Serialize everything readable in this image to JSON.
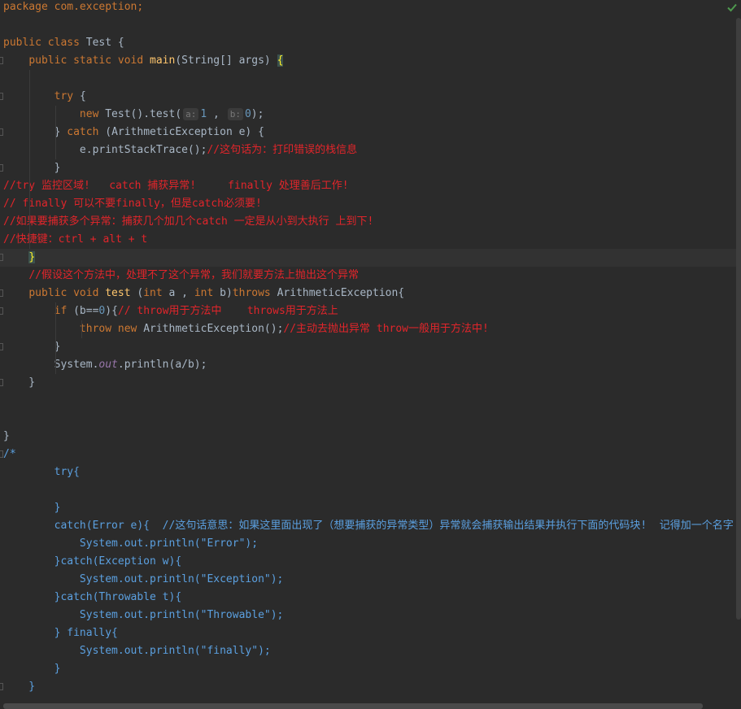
{
  "editor": {
    "status_icon": "check-icon",
    "lines": [
      [
        {
          "t": "package com.exception;",
          "c": "kw2"
        }
      ],
      [],
      [
        {
          "t": "public class ",
          "c": "kw"
        },
        {
          "t": "Test {",
          "c": ""
        }
      ],
      [
        {
          "t": "    "
        },
        {
          "t": "public static void ",
          "c": "kw"
        },
        {
          "t": "main",
          "c": "fn"
        },
        {
          "t": "(String[] args) "
        },
        {
          "t": "{",
          "c": "brace"
        }
      ],
      [],
      [
        {
          "t": "        "
        },
        {
          "t": "try ",
          "c": "kw"
        },
        {
          "t": "{"
        }
      ],
      [
        {
          "t": "            "
        },
        {
          "t": "new ",
          "c": "kw"
        },
        {
          "t": "Test().test("
        },
        {
          "hint": "a:"
        },
        {
          "t": "1",
          "c": "num"
        },
        {
          "t": " , "
        },
        {
          "hint": "b:"
        },
        {
          "t": "0",
          "c": "num"
        },
        {
          "t": ");"
        }
      ],
      [
        {
          "t": "        } "
        },
        {
          "t": "catch ",
          "c": "kw"
        },
        {
          "t": "(ArithmeticException e) {"
        }
      ],
      [
        {
          "t": "            e.printStackTrace();"
        },
        {
          "t": "//这句话为：打印错误的栈信息",
          "c": "red"
        }
      ],
      [
        {
          "t": "        }"
        }
      ],
      [
        {
          "t": "//try 监控区域!   catch 捕获异常!     finally 处理善后工作!",
          "c": "red"
        }
      ],
      [
        {
          "t": "// finally 可以不要finally，但是catch必须要!",
          "c": "red"
        }
      ],
      [
        {
          "t": "//如果要捕获多个异常：捕获几个加几个catch 一定是从小到大执行 上到下!",
          "c": "red"
        }
      ],
      [
        {
          "t": "//快捷键：ctrl + alt + t",
          "c": "red"
        }
      ],
      [
        {
          "t": "    "
        },
        {
          "t": "}",
          "c": "brace"
        }
      ],
      [
        {
          "t": "    "
        },
        {
          "t": "//假设这个方法中，处理不了这个异常，我们就要方法上抛出这个异常",
          "c": "red"
        }
      ],
      [
        {
          "t": "    "
        },
        {
          "t": "public void ",
          "c": "kw"
        },
        {
          "t": "test ",
          "c": "fn"
        },
        {
          "t": "(",
          "c": ""
        },
        {
          "t": "int ",
          "c": "kw"
        },
        {
          "t": "a , "
        },
        {
          "t": "int ",
          "c": "kw"
        },
        {
          "t": "b)"
        },
        {
          "t": "throws ",
          "c": "kw"
        },
        {
          "t": "ArithmeticException{"
        }
      ],
      [
        {
          "t": "        "
        },
        {
          "t": "if ",
          "c": "kw"
        },
        {
          "t": "(b=="
        },
        {
          "t": "0",
          "c": "num"
        },
        {
          "t": "){"
        },
        {
          "t": "// throw用于方法中    throws用于方法上",
          "c": "red"
        }
      ],
      [
        {
          "t": "            "
        },
        {
          "t": "throw new ",
          "c": "kw"
        },
        {
          "t": "ArithmeticException();"
        },
        {
          "t": "//主动去抛出异常 throw一般用于方法中!",
          "c": "red"
        }
      ],
      [
        {
          "t": "        }"
        }
      ],
      [
        {
          "t": "        System."
        },
        {
          "t": "out",
          "c": "field"
        },
        {
          "t": ".println(a/b);"
        }
      ],
      [
        {
          "t": "    }"
        }
      ],
      [],
      [],
      [
        {
          "t": "}"
        }
      ],
      [
        {
          "t": "/*",
          "c": "blue"
        }
      ],
      [
        {
          "t": "        try{",
          "c": "blue"
        }
      ],
      [],
      [
        {
          "t": "        }",
          "c": "blue"
        }
      ],
      [
        {
          "t": "        catch(Error e){  //这句话意思：如果这里面出现了（想要捕获的异常类型）异常就会捕获输出结果并执行下面的代码块!  记得加一个名字",
          "c": "blue"
        }
      ],
      [
        {
          "t": "            System.out.println(\"Error\");",
          "c": "blue"
        }
      ],
      [
        {
          "t": "        }catch(Exception w){",
          "c": "blue"
        }
      ],
      [
        {
          "t": "            System.out.println(\"Exception\");",
          "c": "blue"
        }
      ],
      [
        {
          "t": "        }catch(Throwable t){",
          "c": "blue"
        }
      ],
      [
        {
          "t": "            System.out.println(\"Throwable\");",
          "c": "blue"
        }
      ],
      [
        {
          "t": "        } finally{",
          "c": "blue"
        }
      ],
      [
        {
          "t": "            System.out.println(\"finally\");",
          "c": "blue"
        }
      ],
      [
        {
          "t": "        }",
          "c": "blue"
        }
      ],
      [
        {
          "t": "    }",
          "c": "blue"
        }
      ],
      [
        {
          "t": " */",
          "c": "blue"
        }
      ]
    ]
  }
}
